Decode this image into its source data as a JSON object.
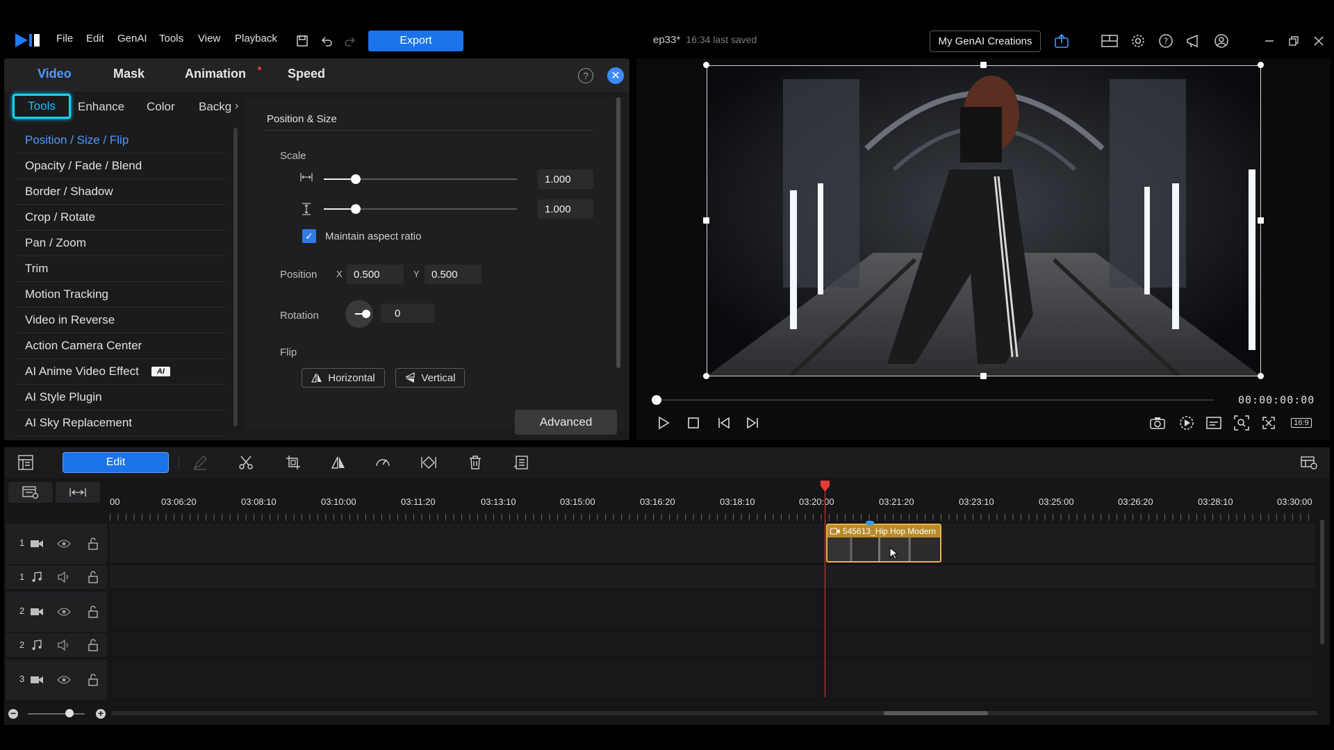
{
  "menu": [
    "File",
    "Edit",
    "GenAI",
    "Tools",
    "View",
    "Playback"
  ],
  "export_label": "Export",
  "project": {
    "name": "ep33*",
    "saved": "16:34 last saved"
  },
  "genai_btn": "My GenAI Creations",
  "panel": {
    "tabs": [
      "Video",
      "Mask",
      "Animation",
      "Speed"
    ],
    "active_tab": "Video",
    "subtabs": [
      "Tools",
      "Enhance",
      "Color",
      "Backg"
    ],
    "tools": [
      "Position / Size / Flip",
      "Opacity / Fade / Blend",
      "Border / Shadow",
      "Crop / Rotate",
      "Pan / Zoom",
      "Trim",
      "Motion Tracking",
      "Video in Reverse",
      "Action Camera Center",
      "AI Anime Video Effect",
      "AI Style Plugin",
      "AI Sky Replacement"
    ],
    "ai_badge": "AI"
  },
  "props": {
    "section_title": "Position & Size",
    "scale_label": "Scale",
    "scale_w": "1.000",
    "scale_h": "1.000",
    "scale_slider_fraction": 0.17,
    "maintain_aspect": "Maintain aspect ratio",
    "position_label": "Position",
    "x_label": "X",
    "x_value": "0.500",
    "y_label": "Y",
    "y_value": "0.500",
    "rotation_label": "Rotation",
    "rotation_value": "0",
    "flip_label": "Flip",
    "flip_h": "Horizontal",
    "flip_v": "Vertical",
    "advanced": "Advanced"
  },
  "preview": {
    "timecode": "00:00:00:00",
    "aspect": "16:9"
  },
  "timeline": {
    "edit_label": "Edit",
    "ruler": [
      "00",
      "03:06:20",
      "03:08:10",
      "03:10:00",
      "03:11:20",
      "03:13:10",
      "03:15:00",
      "03:16:20",
      "03:18:10",
      "03:20:00",
      "03:21:20",
      "03:23:10",
      "03:25:00",
      "03:26:20",
      "03:28:10",
      "03:30:00"
    ],
    "tracks": [
      {
        "num": "1",
        "type": "video"
      },
      {
        "num": "1",
        "type": "audio"
      },
      {
        "num": "2",
        "type": "video"
      },
      {
        "num": "2",
        "type": "audio"
      },
      {
        "num": "3",
        "type": "video"
      }
    ],
    "clip_name": "545613_Hip Hop Modern"
  },
  "colors": {
    "accent": "#1a73e8",
    "highlight": "#10d6ff",
    "playhead": "#e53935",
    "clip": "#e8b44a"
  }
}
